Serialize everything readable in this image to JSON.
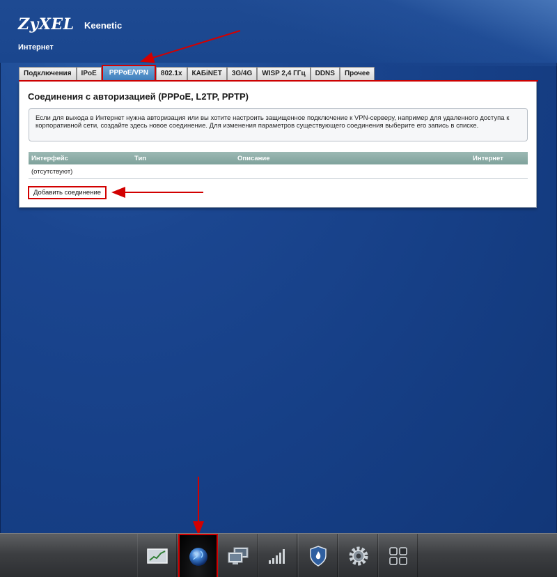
{
  "header": {
    "brand": "ZyXEL",
    "product": "Keenetic",
    "section_title": "Интернет"
  },
  "tabs": [
    {
      "label": "Подключения",
      "active": false
    },
    {
      "label": "IPoE",
      "active": false
    },
    {
      "label": "PPPoE/VPN",
      "active": true
    },
    {
      "label": "802.1x",
      "active": false
    },
    {
      "label": "КАБiNET",
      "active": false
    },
    {
      "label": "3G/4G",
      "active": false
    },
    {
      "label": "WISP 2,4 ГГц",
      "active": false
    },
    {
      "label": "DDNS",
      "active": false
    },
    {
      "label": "Прочее",
      "active": false
    }
  ],
  "panel": {
    "title": "Соединения с авторизацией (PPPoE, L2TP, PPTP)",
    "info_text": "Если для выхода в Интернет нужна авторизация или вы хотите настроить защищенное подключение к VPN-серверу, например для удаленного доступа к корпоративной сети, создайте здесь новое соединение. Для изменения параметров существующего соединения выберите его запись в списке.",
    "table": {
      "columns": [
        "Интерфейс",
        "Тип",
        "Описание",
        "Интернет"
      ],
      "empty_row": "(отсутствуют)"
    },
    "add_button": "Добавить соединение"
  },
  "dock": {
    "items": [
      {
        "icon": "chart-icon",
        "active": false
      },
      {
        "icon": "globe-icon",
        "active": true
      },
      {
        "icon": "computers-icon",
        "active": false
      },
      {
        "icon": "signal-bars-icon",
        "active": false
      },
      {
        "icon": "shield-icon",
        "active": false
      },
      {
        "icon": "gear-icon",
        "active": false
      },
      {
        "icon": "apps-grid-icon",
        "active": false
      }
    ]
  },
  "colors": {
    "highlight_red": "#d20000",
    "background_blue": "#163f86",
    "active_tab": "#3f7fbd",
    "table_header": "#7fa29b"
  }
}
